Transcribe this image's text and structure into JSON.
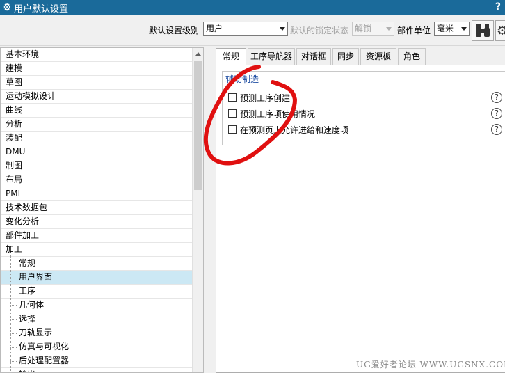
{
  "window": {
    "title": "用户默认设置",
    "help_label": "?"
  },
  "toolbar": {
    "level_label": "默认设置级别",
    "level_value": "用户",
    "lock_label": "默认的锁定状态",
    "lock_value": "解锁",
    "units_label": "部件单位",
    "units_value": "毫米"
  },
  "tree": {
    "items": [
      {
        "label": "基本环境",
        "level": 0
      },
      {
        "label": "建模",
        "level": 0
      },
      {
        "label": "草图",
        "level": 0
      },
      {
        "label": "运动模拟设计",
        "level": 0
      },
      {
        "label": "曲线",
        "level": 0
      },
      {
        "label": "分析",
        "level": 0
      },
      {
        "label": "装配",
        "level": 0
      },
      {
        "label": "DMU",
        "level": 0
      },
      {
        "label": "制图",
        "level": 0
      },
      {
        "label": "布局",
        "level": 0
      },
      {
        "label": "PMI",
        "level": 0
      },
      {
        "label": "技术数据包",
        "level": 0
      },
      {
        "label": "变化分析",
        "level": 0
      },
      {
        "label": "部件加工",
        "level": 0
      },
      {
        "label": "加工",
        "level": 0
      },
      {
        "label": "常规",
        "level": 1
      },
      {
        "label": "用户界面",
        "level": 1,
        "selected": true
      },
      {
        "label": "工序",
        "level": 1
      },
      {
        "label": "几何体",
        "level": 1
      },
      {
        "label": "选择",
        "level": 1
      },
      {
        "label": "刀轨显示",
        "level": 1
      },
      {
        "label": "仿真与可视化",
        "level": 1
      },
      {
        "label": "后处理配置器",
        "level": 1
      },
      {
        "label": "输出",
        "level": 1
      }
    ]
  },
  "tabs": [
    {
      "label": "常规",
      "active": true
    },
    {
      "label": "工序导航器"
    },
    {
      "label": "对话框"
    },
    {
      "label": "同步"
    },
    {
      "label": "资源板"
    },
    {
      "label": "角色"
    }
  ],
  "group": {
    "title": "辅助制造",
    "options": [
      {
        "label": "预测工序创建",
        "checked": false
      },
      {
        "label": "预测工序项使用情况",
        "checked": false
      },
      {
        "label": "在预测页上允许进给和速度项",
        "checked": false
      }
    ],
    "help_glyph": "?"
  },
  "watermark": "UG爱好者论坛 WWW.UGSNX.COM",
  "colors": {
    "titlebar": "#1a6a9a",
    "selected_row": "#cce8f4",
    "group_title": "#1a4aa0",
    "annotation": "#e01010"
  }
}
